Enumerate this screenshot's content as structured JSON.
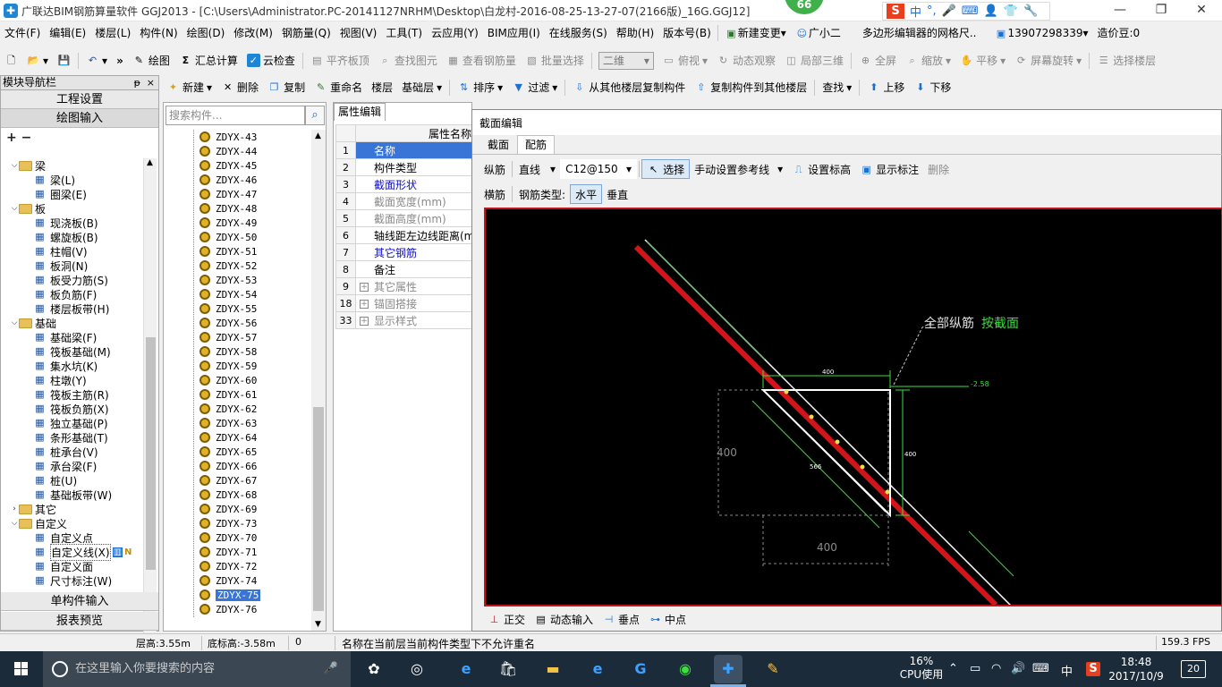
{
  "window": {
    "title": "广联达BIM钢筋算量软件 GGJ2013 - [C:\\Users\\Administrator.PC-20141127NRHM\\Desktop\\白龙村-2016-08-25-13-27-07(2166版)_16G.GGJ12]",
    "badge": "66",
    "ime_label": "中",
    "ime_dot": "°,"
  },
  "menubar": {
    "items": [
      "文件(F)",
      "编辑(E)",
      "楼层(L)",
      "构件(N)",
      "绘图(D)",
      "修改(M)",
      "钢筋量(Q)",
      "视图(V)",
      "工具(T)",
      "云应用(Y)",
      "BIM应用(I)",
      "在线服务(S)",
      "帮助(H)",
      "版本号(B)"
    ],
    "new_change": "新建变更",
    "assistant": "广小二",
    "link": "多边形编辑器的网格尺..",
    "phone": "13907298339",
    "beans": "造价豆:0"
  },
  "toolbar1": {
    "draw": "绘图",
    "sum_calc": "汇总计算",
    "cloud_check": "云检查",
    "flush_slab": "平齐板顶",
    "find_element": "查找图元",
    "view_rebar": "查看钢筋量",
    "batch_select": "批量选择",
    "view_mode": "二维",
    "top_view": "俯视",
    "dynamic_view": "动态观察",
    "local_3d": "局部三维",
    "fullscreen": "全屏",
    "zoom": "缩放",
    "pan": "平移",
    "rotate": "屏幕旋转",
    "select_floor": "选择楼层"
  },
  "toolbar2": {
    "new": "新建",
    "delete": "删除",
    "copy": "复制",
    "rename": "重命名",
    "floor_label": "楼层",
    "floor_value": "基础层",
    "sort": "排序",
    "filter": "过滤",
    "copy_from": "从其他楼层复制构件",
    "copy_to": "复制构件到其他楼层",
    "find": "查找",
    "move_up": "上移",
    "move_down": "下移"
  },
  "module_nav": {
    "title": "模块导航栏",
    "pin": "ᵽ",
    "close": "×",
    "project_settings": "工程设置",
    "drawing_input": "绘图输入",
    "tree_tools": "+ −",
    "tree": [
      {
        "label": "梁",
        "type": "folder",
        "level": 0
      },
      {
        "label": "梁(L)",
        "type": "item",
        "level": 1,
        "icon": "beam-icon"
      },
      {
        "label": "圈梁(E)",
        "type": "item",
        "level": 1,
        "icon": "ring-beam-icon"
      },
      {
        "label": "板",
        "type": "folder",
        "level": 0
      },
      {
        "label": "现浇板(B)",
        "type": "item",
        "level": 1,
        "icon": "slab-icon"
      },
      {
        "label": "螺旋板(B)",
        "type": "item",
        "level": 1,
        "icon": "spiral-slab-icon"
      },
      {
        "label": "柱帽(V)",
        "type": "item",
        "level": 1,
        "icon": "column-cap-icon"
      },
      {
        "label": "板洞(N)",
        "type": "item",
        "level": 1,
        "icon": "slab-hole-icon"
      },
      {
        "label": "板受力筋(S)",
        "type": "item",
        "level": 1,
        "icon": "slab-rebar-icon"
      },
      {
        "label": "板负筋(F)",
        "type": "item",
        "level": 1,
        "icon": "slab-neg-rebar-icon"
      },
      {
        "label": "楼层板带(H)",
        "type": "item",
        "level": 1,
        "icon": "slab-strip-icon"
      },
      {
        "label": "基础",
        "type": "folder",
        "level": 0
      },
      {
        "label": "基础梁(F)",
        "type": "item",
        "level": 1,
        "icon": "foundation-beam-icon"
      },
      {
        "label": "筏板基础(M)",
        "type": "item",
        "level": 1,
        "icon": "raft-icon"
      },
      {
        "label": "集水坑(K)",
        "type": "item",
        "level": 1,
        "icon": "sump-icon"
      },
      {
        "label": "柱墩(Y)",
        "type": "item",
        "level": 1,
        "icon": "pier-icon"
      },
      {
        "label": "筏板主筋(R)",
        "type": "item",
        "level": 1,
        "icon": "raft-main-rebar-icon"
      },
      {
        "label": "筏板负筋(X)",
        "type": "item",
        "level": 1,
        "icon": "raft-neg-rebar-icon"
      },
      {
        "label": "独立基础(P)",
        "type": "item",
        "level": 1,
        "icon": "isolated-footing-icon"
      },
      {
        "label": "条形基础(T)",
        "type": "item",
        "level": 1,
        "icon": "strip-footing-icon"
      },
      {
        "label": "桩承台(V)",
        "type": "item",
        "level": 1,
        "icon": "pile-cap-icon"
      },
      {
        "label": "承台梁(F)",
        "type": "item",
        "level": 1,
        "icon": "cap-beam-icon"
      },
      {
        "label": "桩(U)",
        "type": "item",
        "level": 1,
        "icon": "pile-icon"
      },
      {
        "label": "基础板带(W)",
        "type": "item",
        "level": 1,
        "icon": "foundation-strip-icon"
      },
      {
        "label": "其它",
        "type": "folder",
        "level": 0,
        "collapsed": true
      },
      {
        "label": "自定义",
        "type": "folder",
        "level": 0
      },
      {
        "label": "自定义点",
        "type": "item",
        "level": 1,
        "icon": "custom-point-icon"
      },
      {
        "label": "自定义线(X)",
        "type": "item",
        "level": 1,
        "icon": "custom-line-icon",
        "selected": true
      },
      {
        "label": "自定义面",
        "type": "item",
        "level": 1,
        "icon": "custom-face-icon"
      },
      {
        "label": "尺寸标注(W)",
        "type": "item",
        "level": 1,
        "icon": "dimension-icon"
      }
    ],
    "single_input": "单构件输入",
    "report_preview": "报表预览"
  },
  "component_list": {
    "search_placeholder": "搜索构件...",
    "items": [
      "ZDYX-43",
      "ZDYX-44",
      "ZDYX-45",
      "ZDYX-46",
      "ZDYX-47",
      "ZDYX-48",
      "ZDYX-49",
      "ZDYX-50",
      "ZDYX-51",
      "ZDYX-52",
      "ZDYX-53",
      "ZDYX-54",
      "ZDYX-55",
      "ZDYX-56",
      "ZDYX-57",
      "ZDYX-58",
      "ZDYX-59",
      "ZDYX-60",
      "ZDYX-61",
      "ZDYX-62",
      "ZDYX-63",
      "ZDYX-64",
      "ZDYX-65",
      "ZDYX-66",
      "ZDYX-67",
      "ZDYX-68",
      "ZDYX-69",
      "ZDYX-73",
      "ZDYX-70",
      "ZDYX-71",
      "ZDYX-72",
      "ZDYX-74",
      "ZDYX-75",
      "ZDYX-76"
    ],
    "selected": "ZDYX-75"
  },
  "property_grid": {
    "tab": "属性编辑",
    "header": "属性名称",
    "rows": [
      {
        "n": "1",
        "label": "名称",
        "style": "selected"
      },
      {
        "n": "2",
        "label": "构件类型",
        "style": "normal"
      },
      {
        "n": "3",
        "label": "截面形状",
        "style": "blue"
      },
      {
        "n": "4",
        "label": "截面宽度(mm)",
        "style": "gray"
      },
      {
        "n": "5",
        "label": "截面高度(mm)",
        "style": "gray"
      },
      {
        "n": "6",
        "label": "轴线距左边线距离(mm)",
        "style": "normal"
      },
      {
        "n": "7",
        "label": "其它钢筋",
        "style": "blue"
      },
      {
        "n": "8",
        "label": "备注",
        "style": "normal"
      },
      {
        "n": "9",
        "label": "其它属性",
        "style": "gray",
        "expandable": true
      },
      {
        "n": "18",
        "label": "锚固搭接",
        "style": "gray",
        "expandable": true
      },
      {
        "n": "33",
        "label": "显示样式",
        "style": "gray",
        "expandable": true
      }
    ]
  },
  "section_editor": {
    "title": "截面编辑",
    "tabs": [
      "截面",
      "配筋"
    ],
    "active_tab": "配筋",
    "longitudinal": "纵筋",
    "line_type": "直线",
    "rebar_spec": "C12@150",
    "select": "选择",
    "manual_ref": "手动设置参考线",
    "set_elevation": "设置标高",
    "show_annotation": "显示标注",
    "delete": "删除",
    "transverse": "横筋",
    "rebar_type_label": "钢筋类型:",
    "horizontal": "水平",
    "vertical": "垂直",
    "bottom": {
      "ortho": "正交",
      "dynamic_input": "动态输入",
      "perpendicular": "垂点",
      "midpoint": "中点"
    },
    "canvas": {
      "annotation_prefix": "全部纵筋",
      "annotation_value": "按截面",
      "dim_top": "400",
      "dim_right": "400",
      "dim_left": "400",
      "dim_bottom": "400",
      "dim_diag": "566",
      "elevation": "-2.58"
    }
  },
  "statusbar": {
    "floor_height": "层高:3.55m",
    "bottom_elev": "底标高:-3.58m",
    "zero": "0",
    "message": "名称在当前层当前构件类型下不允许重名",
    "fps": "159.3 FPS"
  },
  "taskbar": {
    "search_placeholder": "在这里输入你要搜索的内容",
    "cpu_percent": "16%",
    "cpu_label": "CPU使用",
    "lang": "中",
    "time": "18:48",
    "date": "2017/10/9",
    "notifications": "20"
  }
}
